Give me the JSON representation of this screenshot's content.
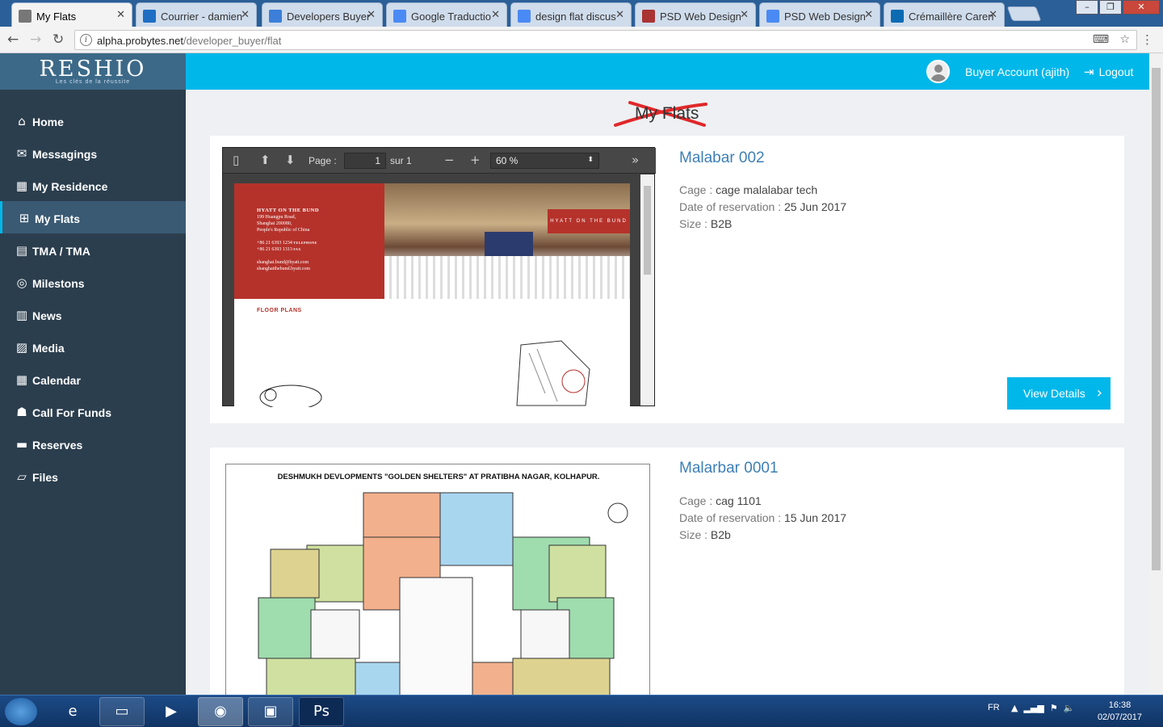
{
  "browser": {
    "tabs": [
      {
        "label": "My Flats",
        "icon": "page-icon",
        "color": "#777"
      },
      {
        "label": "Courrier - damien",
        "icon": "outlook-icon",
        "color": "#1e6fc4"
      },
      {
        "label": "Developers Buyer",
        "icon": "site-icon",
        "color": "#3b7fd8"
      },
      {
        "label": "Google Traductio",
        "icon": "translate-icon",
        "color": "#4a8af4"
      },
      {
        "label": "design flat discus",
        "icon": "google-icon",
        "color": "#4a8af4"
      },
      {
        "label": "PSD Web Design",
        "icon": "psd-icon",
        "color": "#a33"
      },
      {
        "label": "PSD Web Design",
        "icon": "google-icon",
        "color": "#4a8af4"
      },
      {
        "label": "Crémaillère Caren",
        "icon": "trello-icon",
        "color": "#0a6bb3"
      }
    ],
    "url_host": "alpha.probytes.net",
    "url_path": "/developer_buyer/flat"
  },
  "brand": {
    "name": "RESHIO",
    "tagline": "Les clés de la réussite"
  },
  "sidebar": {
    "items": [
      {
        "label": "Home",
        "icon": "home-icon",
        "glyph": "⌂"
      },
      {
        "label": "Messagings",
        "icon": "envelope-icon",
        "glyph": "✉"
      },
      {
        "label": "My Residence",
        "icon": "building-icon",
        "glyph": "▦"
      },
      {
        "label": "My Flats",
        "icon": "grid-icon",
        "glyph": "⊞"
      },
      {
        "label": "TMA / TMA",
        "icon": "document-icon",
        "glyph": "▤"
      },
      {
        "label": "Milestons",
        "icon": "target-icon",
        "glyph": "◎"
      },
      {
        "label": "News",
        "icon": "newspaper-icon",
        "glyph": "▥"
      },
      {
        "label": "Media",
        "icon": "image-icon",
        "glyph": "▨"
      },
      {
        "label": "Calendar",
        "icon": "calendar-icon",
        "glyph": "▦"
      },
      {
        "label": "Call For Funds",
        "icon": "people-icon",
        "glyph": "☗"
      },
      {
        "label": "Reserves",
        "icon": "card-icon",
        "glyph": "▬"
      },
      {
        "label": "Files",
        "icon": "folder-icon",
        "glyph": "▱"
      }
    ],
    "active_index": 3
  },
  "header": {
    "account": "Buyer Account (ajith)",
    "logout": "Logout"
  },
  "page": {
    "title": "My Flats"
  },
  "flats": [
    {
      "name": "Malabar 002",
      "cage_label": "Cage :",
      "cage": "cage malalabar tech",
      "date_label": "Date of reservation :",
      "date": "25 Jun 2017",
      "size_label": "Size :",
      "size": "B2B",
      "button": "View Details",
      "pdf": {
        "page_label": "Page :",
        "page": "1",
        "of": "sur 1",
        "zoom": "60 %",
        "hotel": "HYATT ON THE BUND",
        "addr1": "199 Huangpu Road,",
        "addr2": "Shanghai 200080,",
        "addr3": "People's Republic of China",
        "tel": "+86 21 6393 1234",
        "tel_label": "TELEPHONE",
        "fax": "+86 21 6393 1313",
        "fax_label": "FAX",
        "email": "shanghai.bund@hyatt.com",
        "web": "shanghaithebund.hyatt.com",
        "logo": "HYATT ON THE BUND",
        "section": "FLOOR PLANS"
      }
    },
    {
      "name": "Malarbar 0001",
      "cage_label": "Cage :",
      "cage": "cag 1101",
      "date_label": "Date of reservation :",
      "date": "15 Jun 2017",
      "size_label": "Size :",
      "size": "B2b",
      "plan_title": "DESHMUKH DEVLOPMENTS \"GOLDEN SHELTERS\" AT PRATIBHA NAGAR, KOLHAPUR."
    }
  ],
  "taskbar": {
    "lang": "FR",
    "time": "16:38",
    "date": "02/07/2017"
  }
}
